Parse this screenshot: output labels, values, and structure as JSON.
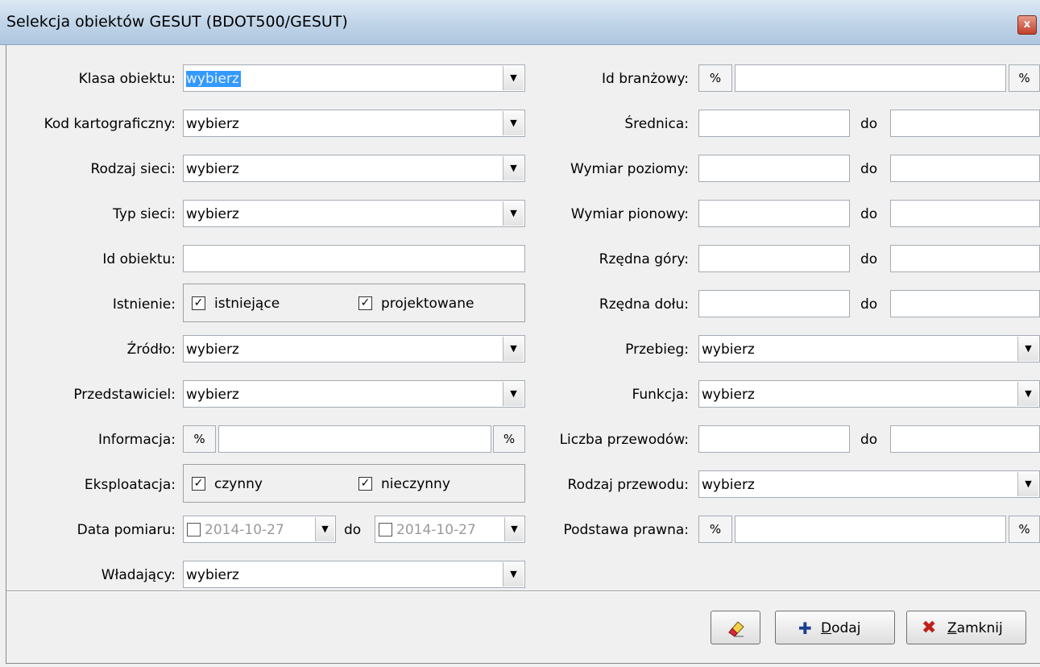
{
  "window": {
    "title": "Selekcja obiektów GESUT (BDOT500/GESUT)",
    "close_label": "x"
  },
  "left": {
    "klasa_label": "Klasa obiektu:",
    "klasa_value": "wybierz",
    "kod_label": "Kod kartograficzny:",
    "kod_value": "wybierz",
    "rodzaj_sieci_label": "Rodzaj sieci:",
    "rodzaj_sieci_value": "wybierz",
    "typ_sieci_label": "Typ sieci:",
    "typ_sieci_value": "wybierz",
    "id_obiektu_label": "Id obiektu:",
    "id_obiektu_value": "",
    "istnienie_label": "Istnienie:",
    "istnienie_opt1": "istniejące",
    "istnienie_opt1_checked": true,
    "istnienie_opt2": "projektowane",
    "istnienie_opt2_checked": true,
    "zrodlo_label": "Źródło:",
    "zrodlo_value": "wybierz",
    "przedstawiciel_label": "Przedstawiciel:",
    "przedstawiciel_value": "wybierz",
    "informacja_label": "Informacja:",
    "informacja_prefix": "%",
    "informacja_value": "",
    "informacja_suffix": "%",
    "eksploatacja_label": "Eksploatacja:",
    "eksploatacja_opt1": "czynny",
    "eksploatacja_opt1_checked": true,
    "eksploatacja_opt2": "nieczynny",
    "eksploatacja_opt2_checked": true,
    "data_label": "Data pomiaru:",
    "data_from": "2014-10-27",
    "data_do": "do",
    "data_to": "2014-10-27",
    "wladajacy_label": "Władający:",
    "wladajacy_value": "wybierz"
  },
  "right": {
    "id_branzowy_label": "Id branżowy:",
    "id_branzowy_prefix": "%",
    "id_branzowy_value": "",
    "id_branzowy_suffix": "%",
    "srednica_label": "Średnica:",
    "wymiar_poziomy_label": "Wymiar poziomy:",
    "wymiar_pionowy_label": "Wymiar pionowy:",
    "rzedna_gory_label": "Rzędna góry:",
    "rzedna_dolu_label": "Rzędna dołu:",
    "do_label": "do",
    "przebieg_label": "Przebieg:",
    "przebieg_value": "wybierz",
    "funkcja_label": "Funkcja:",
    "funkcja_value": "wybierz",
    "liczba_label": "Liczba przewodów:",
    "rodzaj_przewodu_label": "Rodzaj przewodu:",
    "rodzaj_przewodu_value": "wybierz",
    "podstawa_label": "Podstawa prawna:",
    "podstawa_prefix": "%",
    "podstawa_value": "",
    "podstawa_suffix": "%"
  },
  "buttons": {
    "clear_icon": "eraser-icon",
    "dodaj_icon": "plus-icon",
    "dodaj_mnemonic": "D",
    "dodaj_rest": "odaj",
    "zamknij_icon": "close-x-icon",
    "zamknij_mnemonic": "Z",
    "zamknij_rest": "amknij"
  },
  "colors": {
    "selection": "#3399ff",
    "titlebar": "#c4d7ea",
    "plus": "#1a3f8f",
    "close_x": "#c0201a"
  }
}
